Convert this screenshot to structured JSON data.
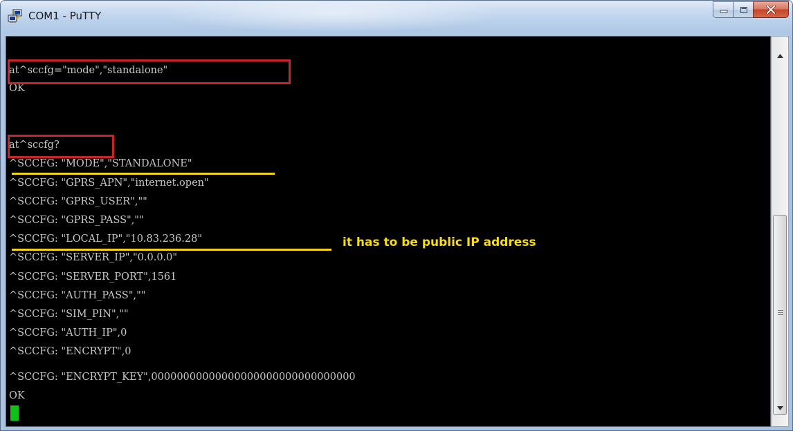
{
  "window": {
    "title": "COM1 - PuTTY",
    "icon": "putty-computers-icon"
  },
  "caption_buttons": {
    "minimize": "minimize-icon",
    "maximize": "maximize-icon",
    "close": "close-icon"
  },
  "terminal": {
    "lines": [
      "at^sccfg=\"mode\",\"standalone\"",
      "OK",
      "at^sccfg?",
      "^SCCFG: \"MODE\",\"STANDALONE\"",
      "^SCCFG: \"GPRS_APN\",\"internet.open\"",
      "^SCCFG: \"GPRS_USER\",\"\"",
      "^SCCFG: \"GPRS_PASS\",\"\"",
      "^SCCFG: \"LOCAL_IP\",\"10.83.236.28\"",
      "^SCCFG: \"SERVER_IP\",\"0.0.0.0\"",
      "^SCCFG: \"SERVER_PORT\",1561",
      "^SCCFG: \"AUTH_PASS\",\"\"",
      "^SCCFG: \"SIM_PIN\",\"\"",
      "^SCCFG: \"AUTH_IP\",0",
      "^SCCFG: \"ENCRYPT\",0",
      "^SCCFG: \"ENCRYPT_KEY\",00000000000000000000000000000000",
      "OK"
    ],
    "annotation": "it has to be public IP address",
    "colors": {
      "background": "#000000",
      "text": "#c8c8c8",
      "highlight_box": "#c9232b",
      "underline": "#f5d41c",
      "note_text": "#f7dd17",
      "cursor": "#11c11a"
    }
  }
}
